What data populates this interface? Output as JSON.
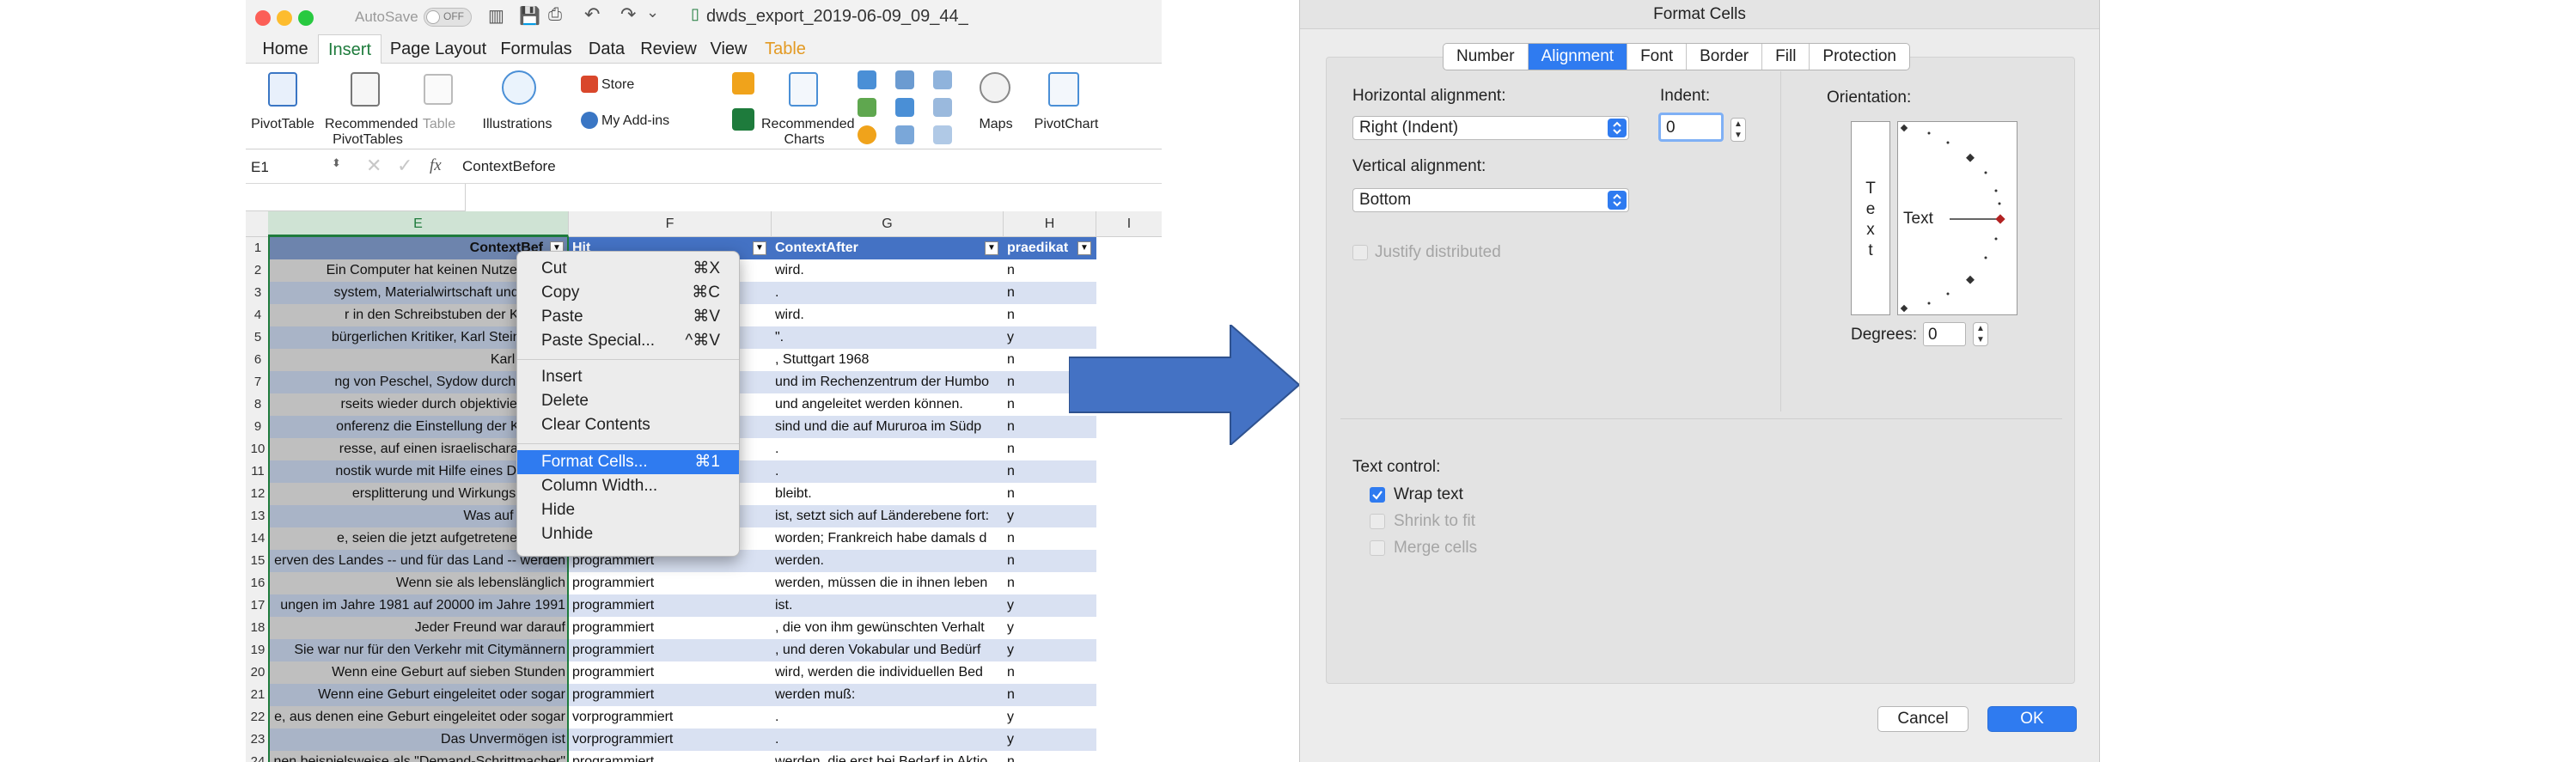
{
  "excel": {
    "autosave_label": "AutoSave",
    "autosave_state": "OFF",
    "filename": "dwds_export_2019-06-09_09_44_",
    "tabs": [
      "Home",
      "Insert",
      "Page Layout",
      "Formulas",
      "Data",
      "Review",
      "View",
      "Table"
    ],
    "ribbon": {
      "pivottable": "PivotTable",
      "recommended_pivot_1": "Recommended",
      "recommended_pivot_2": "PivotTables",
      "table": "Table",
      "illustrations": "Illustrations",
      "store": "Store",
      "my_addins": "My Add-ins",
      "recommended_charts_1": "Recommended",
      "recommended_charts_2": "Charts",
      "maps": "Maps",
      "pivotchart": "PivotChart"
    },
    "namebox": "E1",
    "fx": "fx",
    "formula": "ContextBefore",
    "columns": [
      "E",
      "F",
      "G",
      "H",
      "I"
    ],
    "header_row": {
      "E": "ContextBef",
      "F": "Hit",
      "G": "ContextAfter",
      "H": "praedikat"
    },
    "rows": [
      {
        "n": "2",
        "E": "Ein Computer hat keinen Nutzen, wenn",
        "F": "",
        "G": "wird.",
        "H": "n"
      },
      {
        "n": "3",
        "E": "system, Materialwirtschaft und andere",
        "F": "",
        "G": ".",
        "H": "n"
      },
      {
        "n": "4",
        "E": "r in den Schreibstuben der Katheder",
        "F": "",
        "G": "wird.",
        "H": "n"
      },
      {
        "n": "5",
        "E": "bürgerlichen Kritiker, Karl Steinbuch, a",
        "F": "",
        "G": "\".",
        "H": "y"
      },
      {
        "n": "6",
        "E": "Karl Steinbu",
        "F": "",
        "G": ", Stuttgart 1968",
        "H": "n"
      },
      {
        "n": "7",
        "E": "ng von Peschel, Sydow durch Schmie",
        "F": "",
        "G": "und im Rechenzentrum der Humbo",
        "H": "n"
      },
      {
        "n": "8",
        "E": "rseits wieder durch objektivierende E",
        "F": "",
        "G": "und angeleitet werden können.",
        "H": "n"
      },
      {
        "n": "9",
        "E": "onferenz die Einstellung der Kernvers",
        "F": "",
        "G": "sind und die auf Mururoa im Südp",
        "H": "n"
      },
      {
        "n": "10",
        "E": "resse, auf einen israelischarabischen",
        "F": "",
        "G": ".",
        "H": "n"
      },
      {
        "n": "11",
        "E": "nostik wurde mit Hilfe eines Diplom-In",
        "F": "",
        "G": ".",
        "H": "n"
      },
      {
        "n": "12",
        "E": "ersplitterung und Wirkungslosigkeit",
        "F": "",
        "G": "bleibt.",
        "H": "n"
      },
      {
        "n": "13",
        "E": "Was auf der Bun",
        "F": "",
        "G": "ist, setzt sich auf Länderebene fort:",
        "H": "y"
      },
      {
        "n": "14",
        "E": "e, seien die jetzt aufgetretenen Schwi",
        "F": "",
        "G": "worden; Frankreich habe damals d",
        "H": "n"
      },
      {
        "n": "15",
        "E": "erven des Landes -- und für das Land -- werden",
        "F": "programmiert",
        "G": "werden.",
        "H": "n"
      },
      {
        "n": "16",
        "E": "Wenn sie als lebenslänglich",
        "F": "programmiert",
        "G": "werden, müssen die in ihnen leben",
        "H": "n"
      },
      {
        "n": "17",
        "E": "ungen im Jahre 1981 auf 20000 im Jahre 1991",
        "F": "programmiert",
        "G": "ist.",
        "H": "y"
      },
      {
        "n": "18",
        "E": "Jeder Freund war darauf",
        "F": "programmiert",
        "G": ", die von ihm gewünschten Verhalt",
        "H": "y"
      },
      {
        "n": "19",
        "E": "Sie war nur für den Verkehr mit Citymännern",
        "F": "programmiert",
        "G": ", und deren Vokabular und Bedürf",
        "H": "y"
      },
      {
        "n": "20",
        "E": "Wenn eine Geburt auf sieben Stunden",
        "F": "programmiert",
        "G": "wird, werden die individuellen Bed",
        "H": "n"
      },
      {
        "n": "21",
        "E": "Wenn eine Geburt eingeleitet oder sogar",
        "F": "programmiert",
        "G": "werden muß:",
        "H": "n"
      },
      {
        "n": "22",
        "E": "e, aus denen eine Geburt eingeleitet oder sogar",
        "F": "vorprogrammiert",
        "G": ".",
        "H": "y"
      },
      {
        "n": "23",
        "E": "Das Unvermögen ist",
        "F": "vorprogrammiert",
        "G": ".",
        "H": "y"
      },
      {
        "n": "24",
        "E": "nen beispielsweise als \"Demand-Schrittmacher\"",
        "F": "programmiert",
        "G": "werden, die erst bei Bedarf in Aktio",
        "H": "n"
      }
    ],
    "context_menu": [
      {
        "label": "Cut",
        "shortcut": "⌘X"
      },
      {
        "label": "Copy",
        "shortcut": "⌘C"
      },
      {
        "label": "Paste",
        "shortcut": "⌘V"
      },
      {
        "label": "Paste Special...",
        "shortcut": "^⌘V"
      },
      {
        "label": "Insert",
        "shortcut": ""
      },
      {
        "label": "Delete",
        "shortcut": ""
      },
      {
        "label": "Clear Contents",
        "shortcut": ""
      },
      {
        "label": "Format Cells...",
        "shortcut": "⌘1"
      },
      {
        "label": "Column Width...",
        "shortcut": ""
      },
      {
        "label": "Hide",
        "shortcut": ""
      },
      {
        "label": "Unhide",
        "shortcut": ""
      }
    ]
  },
  "dialog": {
    "title": "Format Cells",
    "tabs": [
      "Number",
      "Alignment",
      "Font",
      "Border",
      "Fill",
      "Protection"
    ],
    "active_tab": "Alignment",
    "horizontal_label": "Horizontal alignment:",
    "horizontal_value": "Right (Indent)",
    "indent_label": "Indent:",
    "indent_value": "0",
    "vertical_label": "Vertical alignment:",
    "vertical_value": "Bottom",
    "justify_label": "Justify distributed",
    "orientation_label": "Orientation:",
    "orientation_vertical_text": [
      "T",
      "e",
      "x",
      "t"
    ],
    "orientation_text": "Text",
    "degrees_label": "Degrees:",
    "degrees_value": "0",
    "text_control_label": "Text control:",
    "wrap_text": "Wrap text",
    "shrink_to_fit": "Shrink to fit",
    "merge_cells": "Merge cells",
    "cancel": "Cancel",
    "ok": "OK"
  },
  "colors": {
    "accent": "#2f7bf0",
    "excel_green": "#1e7b3c",
    "table_blue": "#4472c4",
    "arrow": "#4472c4"
  }
}
